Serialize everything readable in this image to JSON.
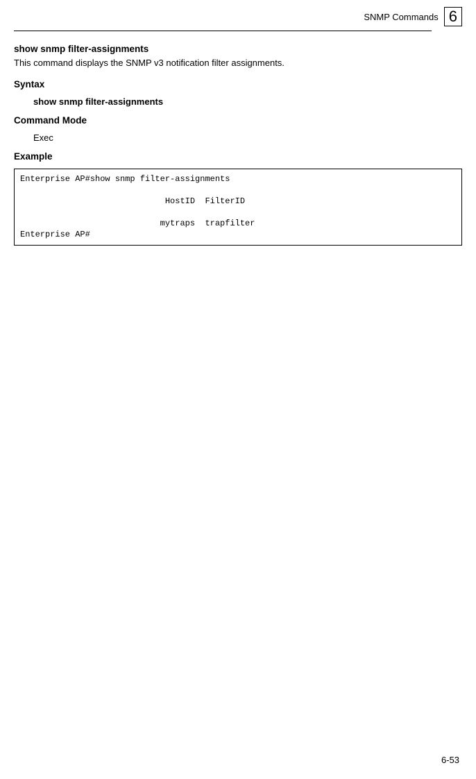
{
  "header": {
    "section": "SNMP Commands",
    "chapter_number": "6"
  },
  "content": {
    "title": "show snmp filter-assignments",
    "description": "This command displays the SNMP v3 notification filter assignments.",
    "syntax_label": "Syntax",
    "syntax_value": "show snmp filter-assignments",
    "command_mode_label": "Command Mode",
    "command_mode_value": "Exec",
    "example_label": "Example",
    "example_block": "Enterprise AP#show snmp filter-assignments\n\n                             HostID  FilterID\n\n                            mytraps  trapfilter\nEnterprise AP#"
  },
  "footer": {
    "page_number": "6-53"
  }
}
